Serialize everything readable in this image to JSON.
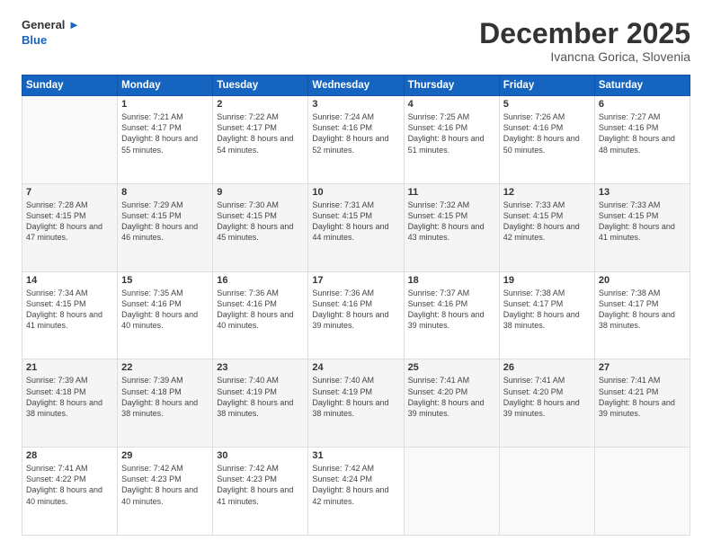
{
  "logo": {
    "line1": "General",
    "line2": "Blue"
  },
  "header": {
    "month": "December 2025",
    "location": "Ivancna Gorica, Slovenia"
  },
  "weekdays": [
    "Sunday",
    "Monday",
    "Tuesday",
    "Wednesday",
    "Thursday",
    "Friday",
    "Saturday"
  ],
  "weeks": [
    [
      {
        "day": "",
        "info": ""
      },
      {
        "day": "1",
        "info": "Sunrise: 7:21 AM\nSunset: 4:17 PM\nDaylight: 8 hours\nand 55 minutes."
      },
      {
        "day": "2",
        "info": "Sunrise: 7:22 AM\nSunset: 4:17 PM\nDaylight: 8 hours\nand 54 minutes."
      },
      {
        "day": "3",
        "info": "Sunrise: 7:24 AM\nSunset: 4:16 PM\nDaylight: 8 hours\nand 52 minutes."
      },
      {
        "day": "4",
        "info": "Sunrise: 7:25 AM\nSunset: 4:16 PM\nDaylight: 8 hours\nand 51 minutes."
      },
      {
        "day": "5",
        "info": "Sunrise: 7:26 AM\nSunset: 4:16 PM\nDaylight: 8 hours\nand 50 minutes."
      },
      {
        "day": "6",
        "info": "Sunrise: 7:27 AM\nSunset: 4:16 PM\nDaylight: 8 hours\nand 48 minutes."
      }
    ],
    [
      {
        "day": "7",
        "info": "Sunrise: 7:28 AM\nSunset: 4:15 PM\nDaylight: 8 hours\nand 47 minutes."
      },
      {
        "day": "8",
        "info": "Sunrise: 7:29 AM\nSunset: 4:15 PM\nDaylight: 8 hours\nand 46 minutes."
      },
      {
        "day": "9",
        "info": "Sunrise: 7:30 AM\nSunset: 4:15 PM\nDaylight: 8 hours\nand 45 minutes."
      },
      {
        "day": "10",
        "info": "Sunrise: 7:31 AM\nSunset: 4:15 PM\nDaylight: 8 hours\nand 44 minutes."
      },
      {
        "day": "11",
        "info": "Sunrise: 7:32 AM\nSunset: 4:15 PM\nDaylight: 8 hours\nand 43 minutes."
      },
      {
        "day": "12",
        "info": "Sunrise: 7:33 AM\nSunset: 4:15 PM\nDaylight: 8 hours\nand 42 minutes."
      },
      {
        "day": "13",
        "info": "Sunrise: 7:33 AM\nSunset: 4:15 PM\nDaylight: 8 hours\nand 41 minutes."
      }
    ],
    [
      {
        "day": "14",
        "info": "Sunrise: 7:34 AM\nSunset: 4:15 PM\nDaylight: 8 hours\nand 41 minutes."
      },
      {
        "day": "15",
        "info": "Sunrise: 7:35 AM\nSunset: 4:16 PM\nDaylight: 8 hours\nand 40 minutes."
      },
      {
        "day": "16",
        "info": "Sunrise: 7:36 AM\nSunset: 4:16 PM\nDaylight: 8 hours\nand 40 minutes."
      },
      {
        "day": "17",
        "info": "Sunrise: 7:36 AM\nSunset: 4:16 PM\nDaylight: 8 hours\nand 39 minutes."
      },
      {
        "day": "18",
        "info": "Sunrise: 7:37 AM\nSunset: 4:16 PM\nDaylight: 8 hours\nand 39 minutes."
      },
      {
        "day": "19",
        "info": "Sunrise: 7:38 AM\nSunset: 4:17 PM\nDaylight: 8 hours\nand 38 minutes."
      },
      {
        "day": "20",
        "info": "Sunrise: 7:38 AM\nSunset: 4:17 PM\nDaylight: 8 hours\nand 38 minutes."
      }
    ],
    [
      {
        "day": "21",
        "info": "Sunrise: 7:39 AM\nSunset: 4:18 PM\nDaylight: 8 hours\nand 38 minutes."
      },
      {
        "day": "22",
        "info": "Sunrise: 7:39 AM\nSunset: 4:18 PM\nDaylight: 8 hours\nand 38 minutes."
      },
      {
        "day": "23",
        "info": "Sunrise: 7:40 AM\nSunset: 4:19 PM\nDaylight: 8 hours\nand 38 minutes."
      },
      {
        "day": "24",
        "info": "Sunrise: 7:40 AM\nSunset: 4:19 PM\nDaylight: 8 hours\nand 38 minutes."
      },
      {
        "day": "25",
        "info": "Sunrise: 7:41 AM\nSunset: 4:20 PM\nDaylight: 8 hours\nand 39 minutes."
      },
      {
        "day": "26",
        "info": "Sunrise: 7:41 AM\nSunset: 4:20 PM\nDaylight: 8 hours\nand 39 minutes."
      },
      {
        "day": "27",
        "info": "Sunrise: 7:41 AM\nSunset: 4:21 PM\nDaylight: 8 hours\nand 39 minutes."
      }
    ],
    [
      {
        "day": "28",
        "info": "Sunrise: 7:41 AM\nSunset: 4:22 PM\nDaylight: 8 hours\nand 40 minutes."
      },
      {
        "day": "29",
        "info": "Sunrise: 7:42 AM\nSunset: 4:23 PM\nDaylight: 8 hours\nand 40 minutes."
      },
      {
        "day": "30",
        "info": "Sunrise: 7:42 AM\nSunset: 4:23 PM\nDaylight: 8 hours\nand 41 minutes."
      },
      {
        "day": "31",
        "info": "Sunrise: 7:42 AM\nSunset: 4:24 PM\nDaylight: 8 hours\nand 42 minutes."
      },
      {
        "day": "",
        "info": ""
      },
      {
        "day": "",
        "info": ""
      },
      {
        "day": "",
        "info": ""
      }
    ]
  ]
}
